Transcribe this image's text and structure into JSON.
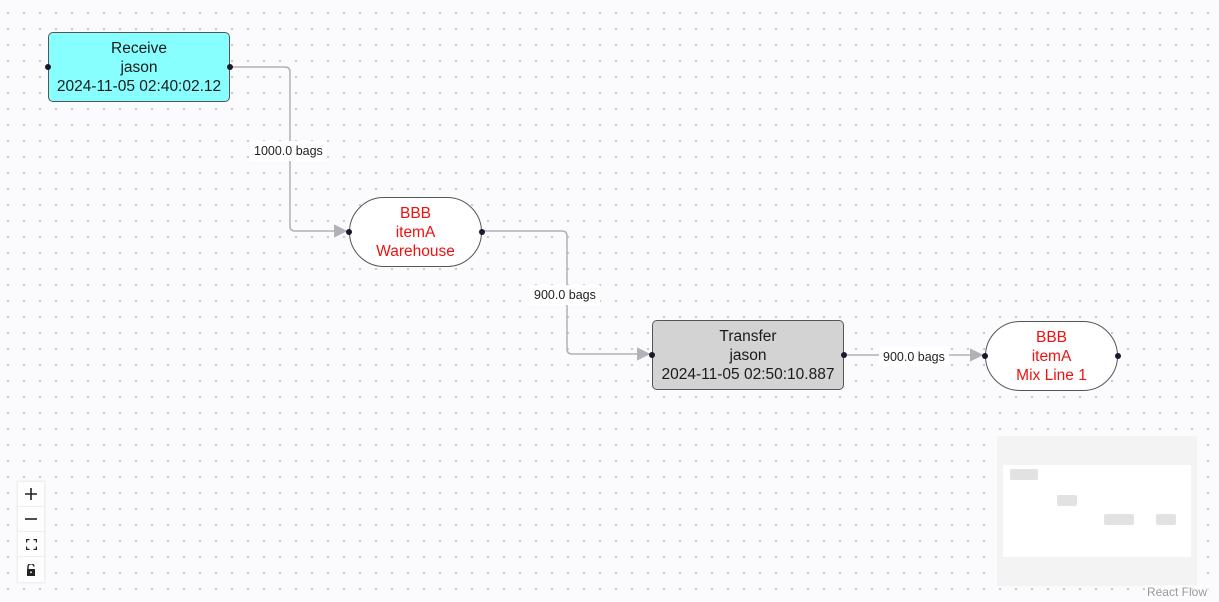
{
  "nodes": [
    {
      "id": "receive",
      "type": "process",
      "lines": [
        "Receive",
        "jason",
        "2024-11-05 02:40:02.12"
      ],
      "fill": "#88ffff",
      "text_color": "#1a1a1a"
    },
    {
      "id": "warehouse",
      "type": "location",
      "lines": [
        "BBB",
        "itemA",
        "Warehouse"
      ],
      "fill": "#ffffff",
      "text_color": "#ee1111"
    },
    {
      "id": "transfer",
      "type": "process",
      "lines": [
        "Transfer",
        "jason",
        "2024-11-05 02:50:10.887"
      ],
      "fill": "#d3d3d3",
      "text_color": "#1a1a1a"
    },
    {
      "id": "mixline",
      "type": "location",
      "lines": [
        "BBB",
        "itemA",
        "Mix Line 1"
      ],
      "fill": "#ffffff",
      "text_color": "#ee1111"
    }
  ],
  "edges": [
    {
      "source": "receive",
      "target": "warehouse",
      "label": "1000.0 bags"
    },
    {
      "source": "warehouse",
      "target": "transfer",
      "label": "900.0 bags"
    },
    {
      "source": "transfer",
      "target": "mixline",
      "label": "900.0 bags"
    }
  ],
  "controls": {
    "zoom_in": "zoom-in-icon",
    "zoom_out": "zoom-out-icon",
    "fit_view": "fit-view-icon",
    "lock": "unlock-icon"
  },
  "attribution": "React Flow"
}
